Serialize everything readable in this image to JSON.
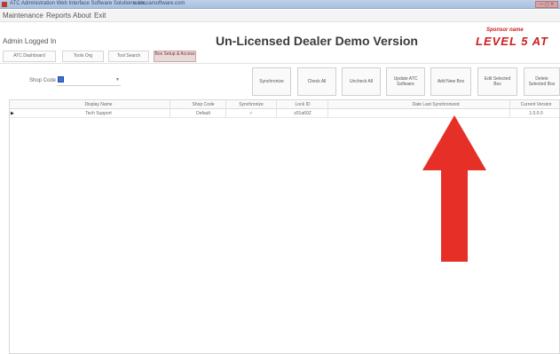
{
  "window": {
    "title": "ATC Administration Web Interface Software Solutions, Inc.",
    "url": "www.carsoftware.com",
    "controls": "— ▢ ✕"
  },
  "menu": {
    "items": [
      "Maintenance",
      "Reports",
      "About",
      "Exit"
    ]
  },
  "header": {
    "login_status": "Admin Logged In",
    "title": "Un-Licensed Dealer Demo Version",
    "logo_top": "Sponsor name",
    "logo_main": "LEVEL 5 AT"
  },
  "nav_tabs": [
    {
      "label": "ATC Dashboard",
      "active": false
    },
    {
      "label": "Tools Org",
      "active": false
    },
    {
      "label": "Tool Search",
      "active": false
    },
    {
      "label": "Box Setup & Access",
      "active": true
    }
  ],
  "filter": {
    "shop_code_label": "Shop Code",
    "shop_code_value": ""
  },
  "actions": [
    "Synchronize",
    "Check All",
    "Uncheck All",
    "Update ATC Software",
    "Add New Box",
    "Edit Selected Box",
    "Delete Selected Box"
  ],
  "table": {
    "columns": [
      "Display Name",
      "Shop Code",
      "Synchronize",
      "Lock ID",
      "Date Last Synchronized",
      "Current Version"
    ],
    "rows": [
      {
        "display_name": "Tech Support",
        "shop_code": "Default",
        "synchronize": "✓",
        "lock_id": "z01a60Z",
        "date_last_synchronized": "",
        "current_version": "1.0.0.0"
      }
    ]
  },
  "annotation": {
    "arrow_color": "#e63027"
  }
}
